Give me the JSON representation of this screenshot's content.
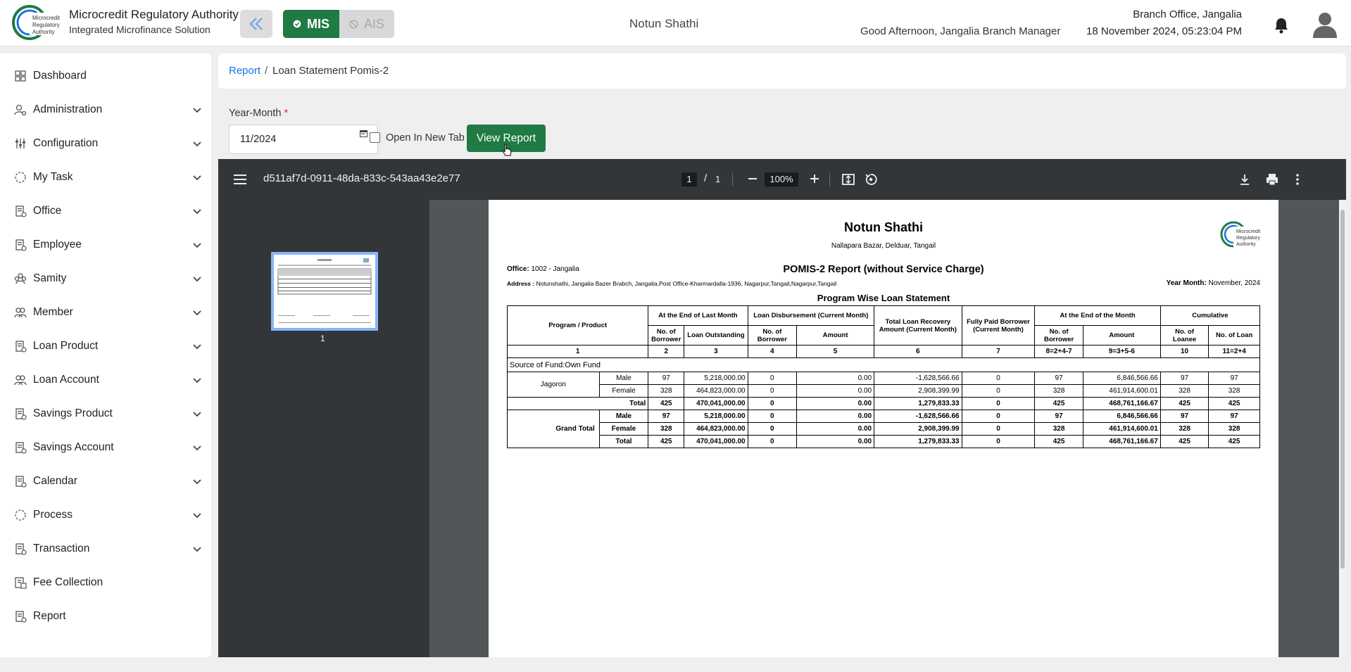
{
  "header": {
    "org_name": "Microcredit Regulatory Authority",
    "org_sub": "Integrated Microfinance Solution",
    "logo_text": "Microcredit Regulatory Authority",
    "mode_mis": "MIS",
    "mode_ais": "AIS",
    "center_title": "Notun Shathi",
    "greeting": "Good Afternoon, Jangalia Branch Manager",
    "branch": "Branch Office, Jangalia",
    "datetime": "18 November 2024, 05:23:04 PM",
    "brand_color": "#1f7a43"
  },
  "sidebar": {
    "items": [
      {
        "label": "Dashboard",
        "icon": "grid-icon",
        "expandable": false
      },
      {
        "label": "Administration",
        "icon": "admin-icon",
        "expandable": true
      },
      {
        "label": "Configuration",
        "icon": "sliders-icon",
        "expandable": true
      },
      {
        "label": "My Task",
        "icon": "task-icon",
        "expandable": true
      },
      {
        "label": "Office",
        "icon": "office-icon",
        "expandable": true
      },
      {
        "label": "Employee",
        "icon": "employee-icon",
        "expandable": true
      },
      {
        "label": "Samity",
        "icon": "samity-icon",
        "expandable": true
      },
      {
        "label": "Member",
        "icon": "member-icon",
        "expandable": true
      },
      {
        "label": "Loan Product",
        "icon": "loan-product-icon",
        "expandable": true
      },
      {
        "label": "Loan Account",
        "icon": "loan-account-icon",
        "expandable": true
      },
      {
        "label": "Savings Product",
        "icon": "savings-product-icon",
        "expandable": true
      },
      {
        "label": "Savings Account",
        "icon": "savings-account-icon",
        "expandable": true
      },
      {
        "label": "Calendar",
        "icon": "calendar-icon",
        "expandable": true
      },
      {
        "label": "Process",
        "icon": "process-icon",
        "expandable": true
      },
      {
        "label": "Transaction",
        "icon": "transaction-icon",
        "expandable": true
      },
      {
        "label": "Fee Collection",
        "icon": "fee-icon",
        "expandable": false
      },
      {
        "label": "Report",
        "icon": "report-icon",
        "expandable": false
      }
    ]
  },
  "breadcrumb": {
    "root": "Report",
    "separator": "/",
    "current": "Loan Statement Pomis-2"
  },
  "form": {
    "year_month_label": "Year-Month",
    "required_mark": "*",
    "year_month_value": "11/2024",
    "open_new_tab_label": "Open In New Tab",
    "view_button": "View Report"
  },
  "pdf": {
    "file_name": "d511af7d-0911-48da-833c-543aa43e2e77",
    "current_page": "1",
    "page_separator": "/",
    "total_pages": "1",
    "zoom": "100%",
    "thumb_label": "1"
  },
  "report": {
    "title": "Notun Shathi",
    "address_line": "Nallapara Bazar, Delduar, Tangail",
    "office_label": "Office:",
    "office_value": "1002 - Jangalia",
    "report_title": "POMIS-2 Report (without Service Charge)",
    "address_label": "Address :",
    "address_value": "Notunshathi, Jangalia Bazer Brabch, Jangalia,Post Office-Kharmardalla-1936, Nagarpur,Tangail,Nagarpur,Tangail",
    "year_month_label": "Year Month:",
    "year_month_value": "November, 2024",
    "subtitle": "Program Wise Loan Statement",
    "headers": {
      "program": "Program / Product",
      "last_month": "At the End of Last Month",
      "disbursement": "Loan Disbursement (Current Month)",
      "recovery": "Total Loan Recovery Amount (Current Month)",
      "fully_paid": "Fully Paid Borrower (Current Month)",
      "end_month": "At the End of the Month",
      "cumulative": "Cumulative",
      "no_borrower": "No. of Borrower",
      "loan_outstanding": "Loan Outstanding",
      "amount": "Amount",
      "no_loanee": "No. of Loanee",
      "no_loan": "No. of Loan"
    },
    "index_row": [
      "1",
      "2",
      "3",
      "4",
      "5",
      "6",
      "7",
      "8=2+4-7",
      "9=3+5-6",
      "10",
      "11=2+4"
    ],
    "fund_label": "Source of Fund:Own Fund",
    "product": "Jagoron",
    "product_rows": [
      [
        "Male",
        "97",
        "5,218,000.00",
        "0",
        "0.00",
        "-1,628,566.66",
        "0",
        "97",
        "6,846,566.66",
        "97",
        "97"
      ],
      [
        "Female",
        "328",
        "464,823,000.00",
        "0",
        "0.00",
        "2,908,399.99",
        "0",
        "328",
        "461,914,600.01",
        "328",
        "328"
      ],
      [
        "Total",
        "425",
        "470,041,000.00",
        "0",
        "0.00",
        "1,279,833.33",
        "0",
        "425",
        "468,761,166.67",
        "425",
        "425"
      ]
    ],
    "grand_total_label": "Grand Total",
    "grand_rows": [
      [
        "Male",
        "97",
        "5,218,000.00",
        "0",
        "0.00",
        "-1,628,566.66",
        "0",
        "97",
        "6,846,566.66",
        "97",
        "97"
      ],
      [
        "Female",
        "328",
        "464,823,000.00",
        "0",
        "0.00",
        "2,908,399.99",
        "0",
        "328",
        "461,914,600.01",
        "328",
        "328"
      ],
      [
        "Total",
        "425",
        "470,041,000.00",
        "0",
        "0.00",
        "1,279,833.33",
        "0",
        "425",
        "468,761,166.67",
        "425",
        "425"
      ]
    ]
  }
}
